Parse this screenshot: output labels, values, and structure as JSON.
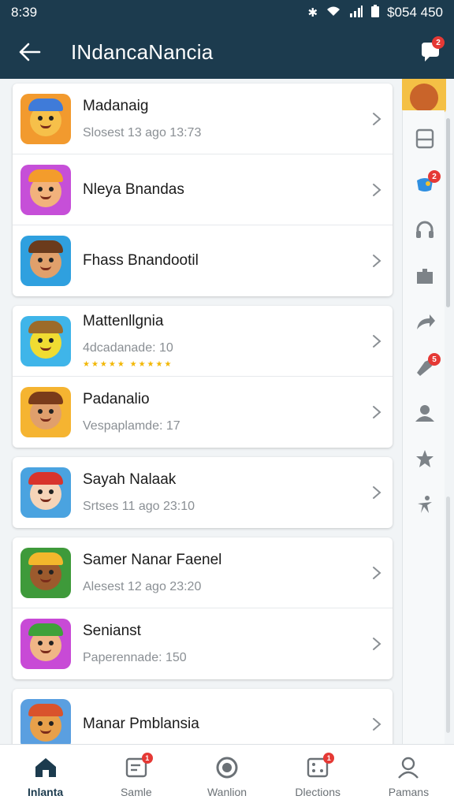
{
  "status_bar": {
    "time": "8:39",
    "right_text": "$054 450"
  },
  "app_bar": {
    "title": "INdancaNancia",
    "chat_badge": "2"
  },
  "cards": [
    {
      "rows": [
        {
          "name": "Madanaig",
          "sub": "Slosest 13 ago 13:73",
          "thumb_bg": "#f29a2e",
          "face": "#f6c04a",
          "hat": "#3f7bd9",
          "icon": "game-character-icon"
        },
        {
          "name": "Nleya Bnandas",
          "sub": "",
          "thumb_bg": "#c64fd8",
          "face": "#f2b27c",
          "hat": "#f39c2c",
          "icon": "game-character-icon"
        },
        {
          "name": "Fhass Bnandootil",
          "sub": "",
          "thumb_bg": "#2fa0df",
          "face": "#e0a06b",
          "hat": "#6b3b1c",
          "icon": "game-character-icon"
        }
      ]
    },
    {
      "rows": [
        {
          "name": "Mattenllgnia",
          "sub": "4dcadanade: 10",
          "stars": "★★★★★ ★★★★★",
          "thumb_bg": "#3fb5e9",
          "face": "#f0dc32",
          "hat": "#9c6b2a",
          "icon": "game-character-icon"
        },
        {
          "name": "Padanalio",
          "sub": "Vespaplamde: 17",
          "thumb_bg": "#f5b431",
          "face": "#e09f6c",
          "hat": "#7a3b1a",
          "icon": "game-character-icon"
        }
      ]
    },
    {
      "rows": [
        {
          "name": "Sayah Nalaak",
          "sub": "Srtses 11 ago 23:10",
          "thumb_bg": "#4aa3e0",
          "face": "#f6d4b8",
          "hat": "#d8342c",
          "icon": "game-character-icon"
        }
      ]
    },
    {
      "rows": [
        {
          "name": "Samer Nanar Faenel",
          "sub": "Alesest 12 ago 23:20",
          "thumb_bg": "#3e9a3a",
          "face": "#9c5a2d",
          "hat": "#f3b72c",
          "icon": "game-character-icon"
        },
        {
          "name": "Senianst",
          "sub": "Paperennade: 150",
          "thumb_bg": "#c84ad6",
          "face": "#f0b686",
          "hat": "#3fa13a",
          "icon": "game-character-icon"
        }
      ]
    },
    {
      "rows": [
        {
          "name": "Manar Pmblansia",
          "sub": "",
          "thumb_bg": "#5a9fe0",
          "face": "#e8a04a",
          "hat": "#d9532c",
          "icon": "game-character-icon"
        }
      ]
    }
  ],
  "rail": [
    {
      "icon": "document-icon",
      "badge": ""
    },
    {
      "icon": "game-controller-icon",
      "badge": "2"
    },
    {
      "icon": "headset-icon",
      "badge": ""
    },
    {
      "icon": "puzzle-icon",
      "badge": ""
    },
    {
      "icon": "share-arrow-icon",
      "badge": ""
    },
    {
      "icon": "rocket-icon",
      "badge": "5"
    },
    {
      "icon": "user-icon",
      "badge": ""
    },
    {
      "icon": "star-icon",
      "badge": ""
    },
    {
      "icon": "figure-icon",
      "badge": ""
    }
  ],
  "bottom_nav": [
    {
      "label": "Inlanta",
      "icon": "home-icon",
      "active": true,
      "badge": ""
    },
    {
      "label": "Samle",
      "icon": "message-icon",
      "active": false,
      "badge": "1"
    },
    {
      "label": "Wanlion",
      "icon": "record-icon",
      "active": false,
      "badge": ""
    },
    {
      "label": "Dlections",
      "icon": "dice-icon",
      "active": false,
      "badge": "1"
    },
    {
      "label": "Pamans",
      "icon": "profile-icon",
      "active": false,
      "badge": ""
    }
  ],
  "colors": {
    "header": "#1c3b4e",
    "badge": "#e53935",
    "star": "#f2b705"
  }
}
